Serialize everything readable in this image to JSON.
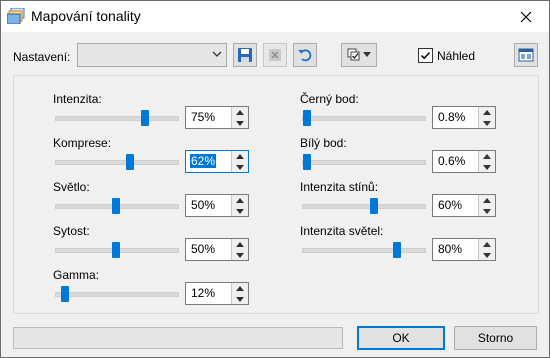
{
  "window": {
    "title": "Mapování tonality"
  },
  "toolbar": {
    "preset_label": "Nastavení:",
    "preset_value": "",
    "preview_label": "Náhled",
    "preview_checked": true
  },
  "left_controls": [
    {
      "label": "Intenzita:",
      "value": "75%",
      "level": 0.75
    },
    {
      "label": "Komprese:",
      "value": "62%",
      "level": 0.62
    },
    {
      "label": "Světlo:",
      "value": "50%",
      "level": 0.5
    },
    {
      "label": "Sytost:",
      "value": "50%",
      "level": 0.5
    },
    {
      "label": "Gamma:",
      "value": "12%",
      "level": 0.05
    }
  ],
  "right_controls": [
    {
      "label": "Černý bod:",
      "value": "0.8%",
      "level": 0.008
    },
    {
      "label": "Bílý bod:",
      "value": "0.6%",
      "level": 0.006
    },
    {
      "label": "Intenzita stínů:",
      "value": "60%",
      "level": 0.6
    },
    {
      "label": "Intenzita světel:",
      "value": "80%",
      "level": 0.8
    }
  ],
  "buttons": {
    "ok": "OK",
    "cancel": "Storno"
  },
  "progress": 0,
  "colors": {
    "accent": "#0078d7"
  }
}
